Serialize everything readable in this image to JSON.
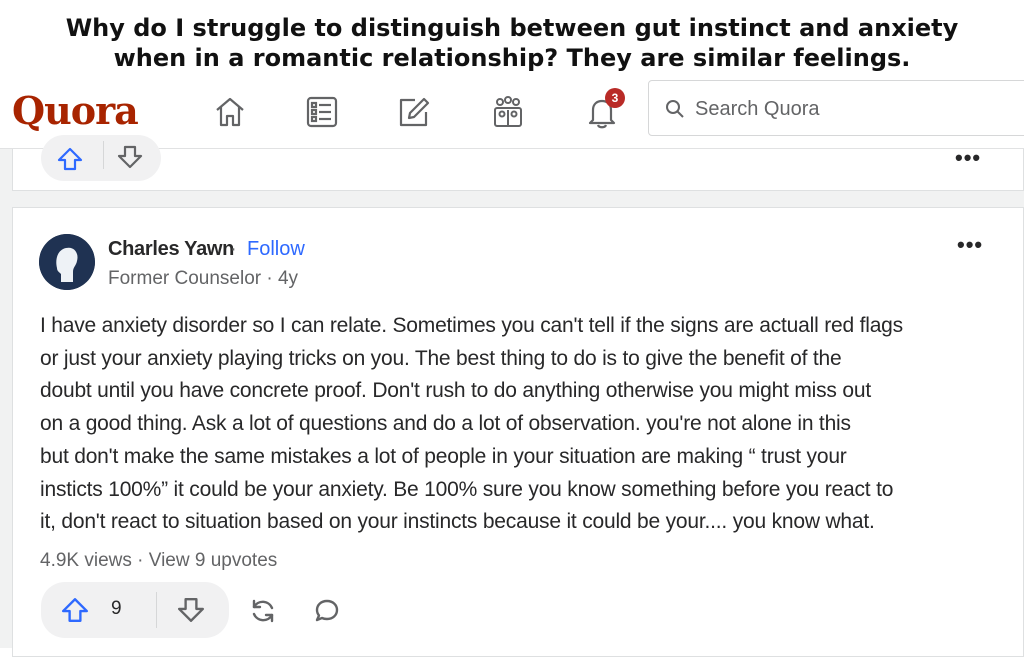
{
  "question": {
    "line1": "Why do I struggle to distinguish between gut instinct and anxiety",
    "line2": "when in a romantic relationship? They are similar feelings."
  },
  "header": {
    "logo": "Quora",
    "nav_icons": [
      "home-icon",
      "following-icon",
      "answer-icon",
      "spaces-icon",
      "notifications-icon"
    ],
    "notification_count": "3",
    "search_placeholder": "Search Quora"
  },
  "answer": {
    "author": "Charles Yawn",
    "separator": "·",
    "follow": "Follow",
    "credential": "Former Counselor · 4y",
    "lines": [
      "I have anxiety disorder so I can relate. Sometimes you can't tell if the signs are actuall red flags",
      "or just your anxiety playing tricks on you. The best thing to do is to give the benefit of the",
      "doubt until you have concrete proof. Don't rush to do anything otherwise you might miss out",
      "on a good thing. Ask a lot of questions and do a lot of observation. you're not alone in this",
      "but don't make the same mistakes a lot of people in your situation are making “ trust your",
      "insticts 100%” it could be your anxiety. Be 100% sure you know something before you react to",
      "it, don't react to situation based on your instincts because it could be your.... you know what."
    ],
    "meta": "4.9K views · View 9 upvotes",
    "upvotes": "9"
  },
  "more_label": "•••",
  "colors": {
    "brand": "#a82400",
    "link": "#2e69ff",
    "badge": "#b92b27",
    "upvote": "#2e69ff"
  }
}
